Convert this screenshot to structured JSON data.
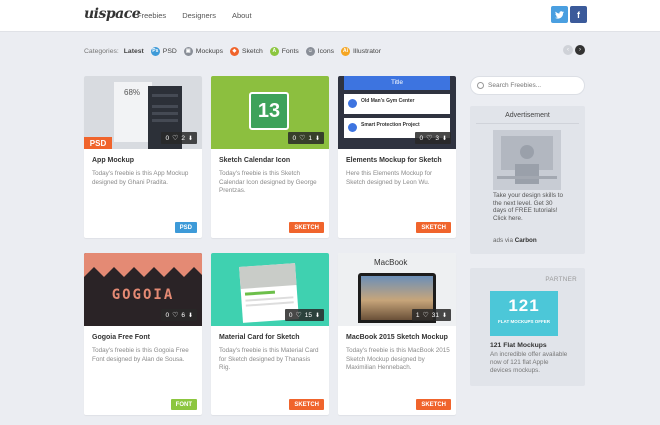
{
  "header": {
    "logo": "uispace",
    "nav": [
      "Freebies",
      "Designers",
      "About"
    ],
    "social": {
      "twitter": "𝕥",
      "facebook": "f"
    }
  },
  "categories": {
    "label": "Categories:",
    "items": [
      {
        "label": "Latest",
        "color": ""
      },
      {
        "label": "PSD",
        "color": "#3d9ad8"
      },
      {
        "label": "Mockups",
        "color": "#8a8f98"
      },
      {
        "label": "Sketch",
        "color": "#f0642c"
      },
      {
        "label": "Fonts",
        "color": "#8cc63f"
      },
      {
        "label": "Icons",
        "color": "#8a8f98"
      },
      {
        "label": "Illustrator",
        "color": "#f5a623"
      }
    ]
  },
  "cards": [
    {
      "title": "App Mockup",
      "desc": "Today's freebie is this App Mockup designed by Ghani Pradita.",
      "likes": "0",
      "downloads": "2",
      "tag": "PSD"
    },
    {
      "title": "Sketch Calendar Icon",
      "desc": "Today's freebie is this Sketch Calendar Icon designed by George Prentzas.",
      "likes": "0",
      "downloads": "1",
      "tag": "SKETCH"
    },
    {
      "title": "Elements Mockup for Sketch",
      "desc": "Here this Elements Mockup for Sketch designed by Leon Wu.",
      "likes": "0",
      "downloads": "3",
      "tag": "SKETCH"
    },
    {
      "title": "Gogoia Free Font",
      "desc": "Today's freebie is this Gogoia Free Font designed by Alan de Sousa.",
      "likes": "0",
      "downloads": "6",
      "tag": "FONT"
    },
    {
      "title": "Material Card for Sketch",
      "desc": "Today's freebie is this Material Card for Sketch designed by Thanasis Rig.",
      "likes": "0",
      "downloads": "15",
      "tag": "SKETCH"
    },
    {
      "title": "MacBook 2015 Sketch Mockup",
      "desc": "Today's freebie is this MacBook 2015 Sketch Mockup designed by Maximilian Hennebach.",
      "likes": "1",
      "downloads": "31",
      "tag": "SKETCH"
    }
  ],
  "thumbs": {
    "app_percent": "68%",
    "app_badge": "PSD",
    "calendar_day": "13",
    "elements_title": "Title",
    "elements_item1": "Old Man's Gym Center",
    "elements_item2": "Smart Protection Project",
    "font_word": "GOGOIA",
    "macbook_label": "MacBook"
  },
  "sidebar": {
    "search_placeholder": "Search Freebies...",
    "ad_heading": "Advertisement",
    "ad_text": "Take your design skills to the next level. Get 30 days of FREE tutorials! Click here.",
    "ads_via": "ads via",
    "ads_via_brand": "Carbon",
    "partner_label": "PARTNER",
    "partner_number": "121",
    "partner_sub": "FLAT MOCKUPS OFFER",
    "partner_title": "121 Flat Mockups",
    "partner_desc": "An incredible offer available now of 121 flat Apple devices mockups."
  }
}
